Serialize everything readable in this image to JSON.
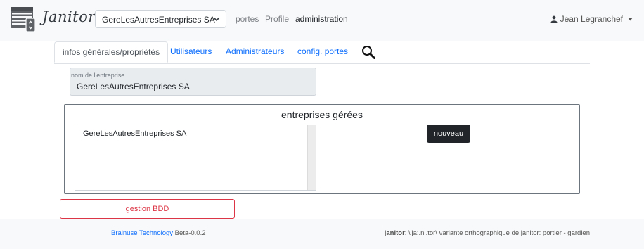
{
  "header": {
    "brand": "Janitor",
    "company_select": {
      "value": "GereLesAutresEntreprises SA"
    },
    "nav": [
      {
        "label": "portes"
      },
      {
        "label": "Profile"
      },
      {
        "label": "administration"
      }
    ],
    "user": {
      "name": "Jean Legranchef"
    }
  },
  "tabs": [
    {
      "label": "infos générales/propriétés"
    },
    {
      "label": "Utilisateurs"
    },
    {
      "label": "Administrateurs"
    },
    {
      "label": "config. portes"
    }
  ],
  "company_field": {
    "label": "nom de l'entreprise",
    "value": "GereLesAutresEntreprises SA"
  },
  "managed": {
    "title": "entreprises gérées",
    "items": [
      "GereLesAutresEntreprises SA"
    ],
    "new_button": "nouveau"
  },
  "db_button": "gestion BDD",
  "footer": {
    "company_link": "Brainuse Technology",
    "version": "Beta-0.0.2",
    "definition_word": "janitor",
    "definition_text": ": \\'ja:.ni.tor\\ variante orthographique de janitor: portier - gardien"
  },
  "colors": {
    "primary": "#0d6efd",
    "danger": "#dc3545",
    "dark": "#212529",
    "header_bg": "#f8f9fa"
  },
  "icons": [
    "server-logo-icon",
    "chevron-down-icon",
    "person-icon",
    "caret-down-icon",
    "search-icon"
  ]
}
